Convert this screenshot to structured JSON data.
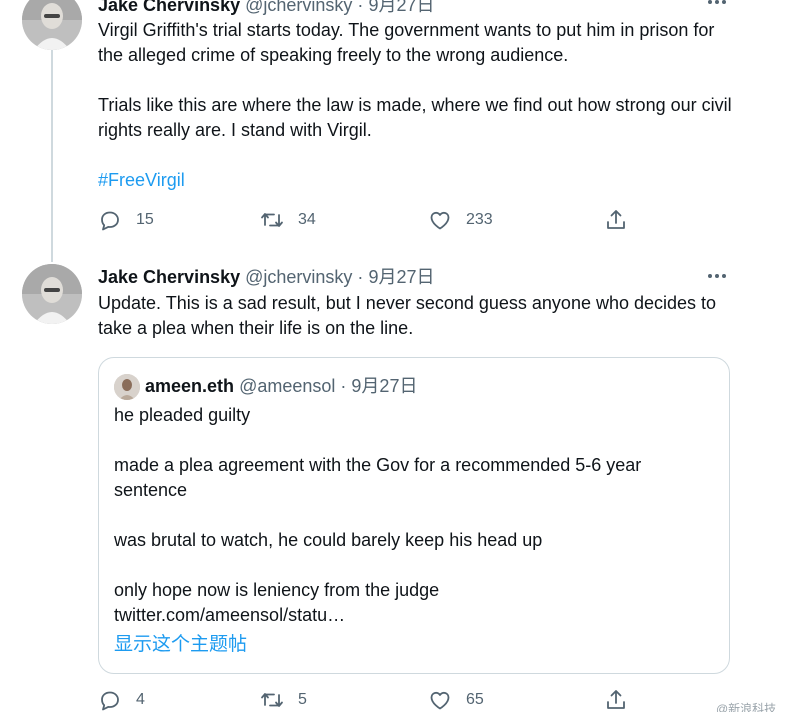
{
  "tweet1": {
    "author_name": "Jake Chervinsky",
    "handle": "@jchervinsky",
    "separator": "·",
    "date": "9月27日",
    "paragraphs": [
      "Virgil Griffith's trial starts today. The government wants to put him in prison for the alleged crime of speaking freely to the wrong audience.",
      "Trials like this are where the law is made, where we find out how strong our civil rights really are. I stand with Virgil."
    ],
    "hashtag": "#FreeVirgil",
    "replies": "15",
    "retweets": "34",
    "likes": "233"
  },
  "tweet2": {
    "author_name": "Jake Chervinsky",
    "handle": "@jchervinsky",
    "separator": "·",
    "date": "9月27日",
    "text": "Update. This is a sad result, but I never second guess anyone who decides to take a plea when their life is on the line.",
    "replies": "4",
    "retweets": "5",
    "likes": "65",
    "quote": {
      "author_name": "ameen.eth",
      "handle": "@ameensol",
      "separator": "·",
      "date": "9月27日",
      "lines": {
        "l1": "he pleaded guilty",
        "l2": "made a plea agreement with the Gov for a recommended 5-6 year sentence",
        "l3": "was brutal to watch, he could barely keep his head up",
        "l4": "only hope now is leniency from the judge",
        "l5": "twitter.com/ameensol/statu…"
      },
      "show_thread": "显示这个主题帖"
    }
  },
  "watermark": "@新浪科技",
  "icons": {
    "reply": "reply-icon",
    "retweet": "retweet-icon",
    "like": "heart-icon",
    "share": "share-icon",
    "more": "more-icon"
  },
  "colors": {
    "link": "#1d9bf0",
    "secondary_text": "#536471",
    "border": "#cfd9de"
  }
}
